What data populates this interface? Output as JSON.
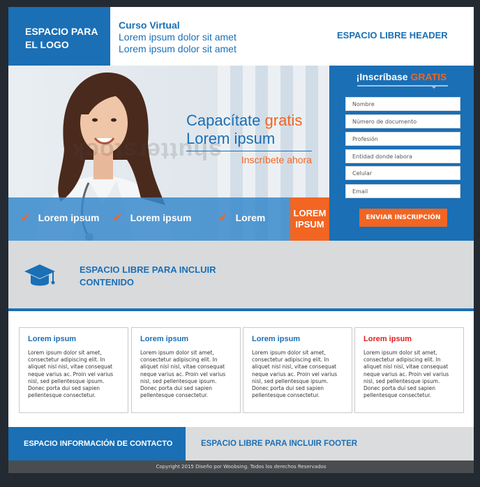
{
  "header": {
    "logo_text": "ESPACIO PARA EL LOGO",
    "course_title": "Curso Virtual",
    "course_lines": [
      "Lorem ipsum dolor sit amet",
      "Lorem ipsum dolor sit amet"
    ],
    "free_space": "ESPACIO LIBRE HEADER"
  },
  "hero": {
    "headline_a": "Capacítate",
    "headline_b": "gratis",
    "headline_line2": "Lorem ipsum",
    "cta_sub": "Inscríbete ahora",
    "watermark": "shutterstock",
    "benefits": [
      "Lorem ipsum",
      "Lorem ipsum",
      "Lorem"
    ],
    "benefit_button": "LOREM IPSUM"
  },
  "form": {
    "title_a": "¡Inscríbase",
    "title_b": "GRATIS",
    "fields": [
      "Nombre",
      "Número de documento",
      "Profesión",
      "Entidad donde labora",
      "Celular",
      "Email"
    ],
    "submit_label": "ENVIAR INSCRIPCIÓN"
  },
  "content_band": {
    "icon": "graduation-cap-icon",
    "line1": "ESPACIO LIBRE PARA INCLUIR",
    "line2": "CONTENIDO"
  },
  "cards": [
    {
      "title": "Lorem ipsum",
      "body": "Lorem ipsum dolor sit amet, consectetur adipiscing elit. In aliquet nisl nisl, vitae consequat neque varius ac. Proin vel varius nisl, sed pellentesque ipsum. Donec porta dui sed sapien pellentesque consectetur."
    },
    {
      "title": "Lorem ipsum",
      "body": "Lorem ipsum dolor sit amet, consectetur adipiscing elit. In aliquet nisl nisl, vitae consequat neque varius ac. Proin vel varius nisl, sed pellentesque ipsum. Donec porta dui sed sapien pellentesque consectetur."
    },
    {
      "title": "Lorem ipsum",
      "body": "Lorem ipsum dolor sit amet, consectetur adipiscing elit. In aliquet nisl nisl, vitae consequat neque varius ac. Proin vel varius nisl, sed pellentesque ipsum. Donec porta dui sed sapien pellentesque consectetur."
    },
    {
      "title": "Lorem ipsum",
      "body": "Lorem ipsum dolor sit amet, consectetur adipiscing elit. In aliquet nisl nisl, vitae consequat neque varius ac. Proin vel varius nisl, sed pellentesque ipsum. Donec porta dui sed sapien pellentesque consectetur."
    }
  ],
  "footer": {
    "contact": "ESPACIO INFORMACIÓN DE CONTACTO",
    "free_space": "ESPACIO LIBRE PARA INCLUIR FOOTER",
    "copyright": "Copyright 2015 Diseño por Woobsing. Todos los derechos Reservados"
  },
  "colors": {
    "primary": "#1a6fb5",
    "accent": "#f26522",
    "card_highlight": "#e02020"
  }
}
